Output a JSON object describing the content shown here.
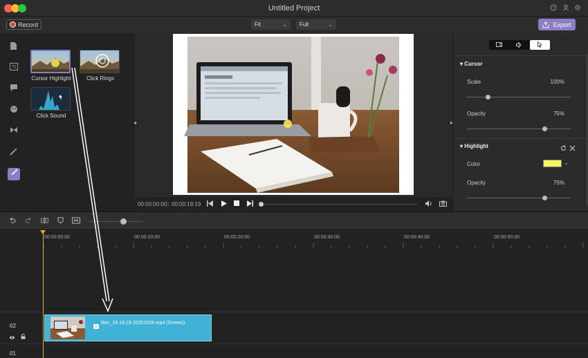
{
  "window": {
    "title": "Untitled Project",
    "help_icon": "help-icon",
    "account_icon": "account-icon",
    "settings_icon": "settings-icon"
  },
  "toolbar": {
    "record_label": "Record",
    "fit_select": "Fit",
    "quality_select": "Full",
    "export_label": "Export"
  },
  "sidebar": {
    "items": [
      {
        "name": "media-icon"
      },
      {
        "name": "text-icon"
      },
      {
        "name": "annotation-icon"
      },
      {
        "name": "sticker-icon"
      },
      {
        "name": "transition-icon"
      },
      {
        "name": "effects-icon"
      },
      {
        "name": "cursor-effects-icon",
        "active": true
      }
    ]
  },
  "library": {
    "effects": [
      {
        "label": "Cursor Highlight",
        "selected": true
      },
      {
        "label": "Click Rings",
        "selected": false
      },
      {
        "label": "Click Sound",
        "selected": false
      }
    ]
  },
  "preview": {
    "current_time": "00:00:00:00",
    "total_time": "00:00:18:19"
  },
  "properties": {
    "tabs": [
      "video-icon",
      "audio-icon",
      "cursor-icon"
    ],
    "active_tab": "cursor-icon",
    "cursor_section": {
      "title": "Cursor",
      "scale_label": "Scale",
      "scale_value": "100%",
      "scale_level": 0.2,
      "opacity_label": "Opacity",
      "opacity_value": "75%",
      "opacity_level": 0.75
    },
    "highlight_section": {
      "title": "Highlight",
      "color_label": "Color",
      "color_value": "#f8f560",
      "opacity_label": "Opacity",
      "opacity_value": "75%",
      "opacity_level": 0.75
    }
  },
  "timeline": {
    "ruler": [
      "00:00:00:00",
      "00:00:10:00",
      "00:00:20:00",
      "00:00:30:00",
      "00:00:40:00",
      "00:00:50:00"
    ],
    "tracks": [
      {
        "number": "02",
        "clip_label": "Rec_16.19.19 20201028.mp4 (Screen)"
      },
      {
        "number": "01"
      }
    ]
  },
  "colors": {
    "accent": "#8b7ec4",
    "clip": "#3fb2d6",
    "playhead": "#e9a825",
    "record": "#e0433f"
  }
}
